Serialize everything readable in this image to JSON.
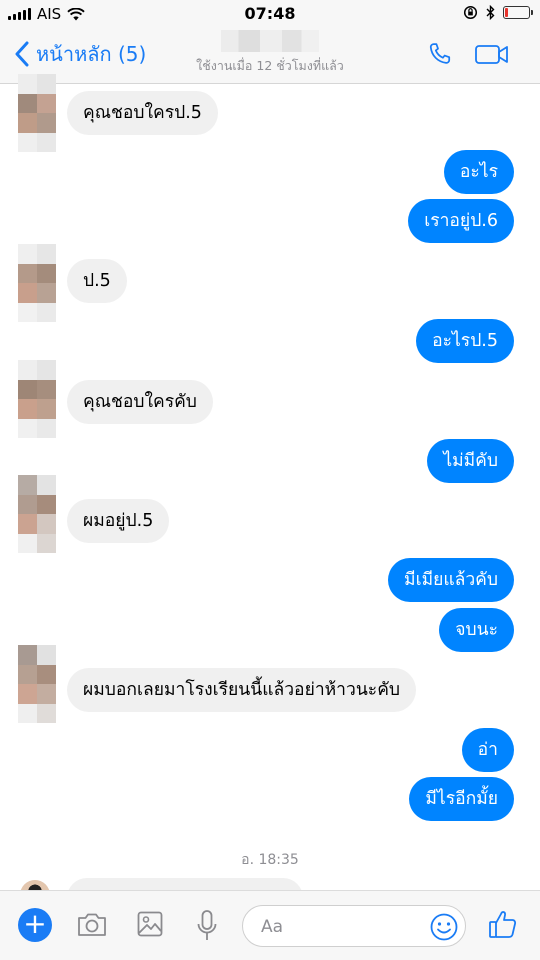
{
  "status_bar": {
    "carrier": "AIS",
    "time": "07:48",
    "battery_level": 0.12
  },
  "header": {
    "back_label": "หน้าหลัก (5)",
    "contact_subtitle": "ใช้งานเมื่อ 12 ชั่วโมงที่แล้ว",
    "call_icon": "phone-icon",
    "video_icon": "video-camera-icon"
  },
  "messages": [
    {
      "text": "คุณชอบใครป.5"
    },
    {
      "text": "อะไร"
    },
    {
      "text": "เราอยู่ป.6"
    },
    {
      "text": "ป.5"
    },
    {
      "text": "อะไรป.5"
    },
    {
      "text": "คุณชอบใครคับ"
    },
    {
      "text": "ไม่มีคับ"
    },
    {
      "text": "ผมอยู่ป.5"
    },
    {
      "text": "มีเมียแล้วคับ"
    },
    {
      "text": "จบนะ"
    },
    {
      "text": "ผมบอกเลยมาโรงเรียนนี้แล้วอย่าห้าวนะคับ"
    },
    {
      "text": "อ่า"
    },
    {
      "text": "มีไรอีกมั้ย"
    }
  ],
  "timestamp": "อ. 18:35",
  "composer": {
    "placeholder": "Aa",
    "icons": [
      "plus-icon",
      "camera-icon",
      "image-icon",
      "microphone-icon",
      "emoji-icon",
      "thumbs-up-icon"
    ]
  },
  "colors": {
    "accent": "#1a7cf5",
    "outgoing_bubble": "#0084ff",
    "incoming_bubble": "#f0f0f0"
  }
}
